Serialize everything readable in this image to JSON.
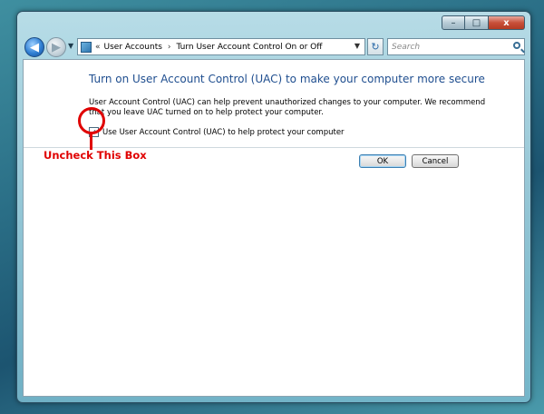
{
  "window": {
    "controls": {
      "minimize": "–",
      "maximize": "□",
      "close": "x"
    }
  },
  "nav": {
    "back_icon": "back-arrow-icon",
    "forward_icon": "forward-arrow-icon",
    "breadcrumb": [
      "User Accounts",
      "Turn User Account Control On or Off"
    ],
    "breadcrumb_chevron": "«",
    "breadcrumb_separator": "›",
    "search_placeholder": "Search"
  },
  "main": {
    "heading": "Turn on User Account Control (UAC) to make your computer more secure",
    "description": "User Account Control (UAC) can help prevent unauthorized changes to your computer.  We recommend that you leave UAC turned on to help protect your computer.",
    "checkbox_label": "Use User Account Control (UAC) to help protect your computer",
    "checkbox_checked": true,
    "checkbox_mark": "✓",
    "ok_label": "OK",
    "cancel_label": "Cancel"
  },
  "annotation": {
    "text": "Uncheck This Box",
    "color": "#e00000"
  },
  "colors": {
    "heading": "#1f4e8f",
    "annotation": "#e00000"
  }
}
